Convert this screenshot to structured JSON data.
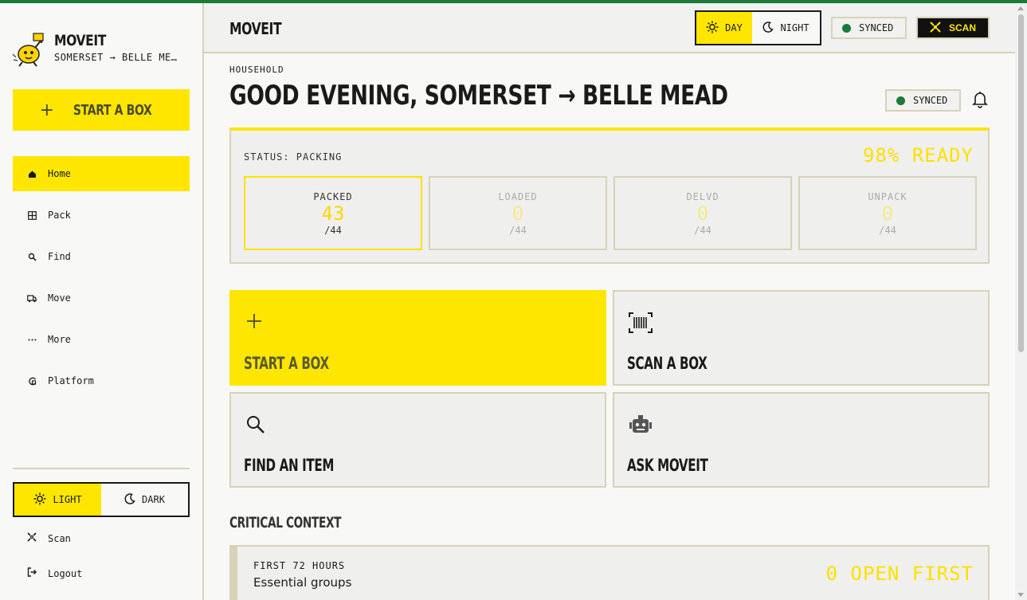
{
  "sidebar": {
    "brand": "MOVEIT",
    "route": "SOMERSET → BELLE ME…",
    "start_box": "START A BOX",
    "items": [
      {
        "label": "Home",
        "icon": "home-icon",
        "glyph": "⌂",
        "active": true
      },
      {
        "label": "Pack",
        "icon": "pack-icon",
        "glyph": "⊞",
        "active": false
      },
      {
        "label": "Find",
        "icon": "search-icon",
        "glyph": "⚲",
        "active": false
      },
      {
        "label": "Move",
        "icon": "truck-icon",
        "glyph": "⛟",
        "active": false
      },
      {
        "label": "More",
        "icon": "more-icon",
        "glyph": "⋯",
        "active": false
      },
      {
        "label": "Platform",
        "icon": "platform-icon",
        "glyph": "G",
        "active": false
      }
    ],
    "theme": {
      "light": "LIGHT",
      "dark": "DARK",
      "selected": "light"
    },
    "scan": "Scan",
    "logout": "Logout"
  },
  "header": {
    "title": "MOVEIT",
    "day": "DAY",
    "night": "NIGHT",
    "synced": "SYNCED",
    "scan": "SCAN"
  },
  "main": {
    "kicker": "HOUSEHOLD",
    "greeting": "GOOD EVENING, SOMERSET → BELLE MEAD",
    "synced": "SYNCED",
    "status": {
      "label": "STATUS: PACKING",
      "ready": "98% READY",
      "stages": [
        {
          "name": "PACKED",
          "value": "43",
          "total": "/44",
          "active": true
        },
        {
          "name": "LOADED",
          "value": "0",
          "total": "/44",
          "active": false
        },
        {
          "name": "DELVD",
          "value": "0",
          "total": "/44",
          "active": false
        },
        {
          "name": "UNPACK",
          "value": "0",
          "total": "/44",
          "active": false
        }
      ]
    },
    "actions": {
      "start": "START A BOX",
      "scan": "SCAN A BOX",
      "find": "FIND AN ITEM",
      "ask": "ASK MOVEIT"
    },
    "critical": {
      "title": "CRITICAL CONTEXT",
      "kicker": "FIRST 72 HOURS",
      "name": "Essential groups",
      "count": "0 OPEN FIRST"
    }
  },
  "colors": {
    "accent": "#ffe600",
    "synced": "#1b7a3a",
    "border": "#d8d2b8",
    "topline": "#1b7a3a"
  }
}
